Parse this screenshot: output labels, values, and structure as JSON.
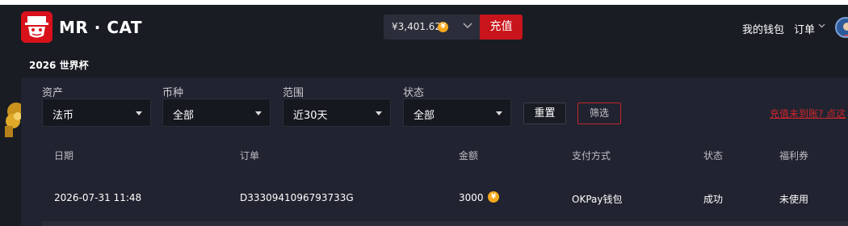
{
  "brand": {
    "name": "MR · CAT"
  },
  "wallet": {
    "balance": "¥3,401.62",
    "coin_symbol": "¥",
    "charge_label": "充值"
  },
  "nav": {
    "wallet_label": "我的钱包",
    "orders_label": "订单"
  },
  "subnav": {
    "label": "2026 世界杯"
  },
  "filters": {
    "asset": {
      "label": "资产",
      "value": "法币"
    },
    "currency": {
      "label": "币种",
      "value": "全部"
    },
    "range": {
      "label": "范围",
      "value": "近30天"
    },
    "status": {
      "label": "状态",
      "value": "全部"
    },
    "reset_label": "重置",
    "filter_label": "筛选",
    "unpaid_link": "充值未到账? 点这"
  },
  "table": {
    "headers": [
      "日期",
      "订单",
      "金额",
      "支付方式",
      "状态",
      "福利券"
    ],
    "rows": [
      {
        "date": "2026-07-31 11:48",
        "order": "D3330941096793733G",
        "amount": "3000",
        "coin": "¥",
        "method": "OKPay钱包",
        "status": "成功",
        "coupon": "未使用"
      }
    ]
  },
  "colors": {
    "accent": "#c8151c",
    "background": "#1b1d27",
    "coin": "#f4a81b"
  }
}
